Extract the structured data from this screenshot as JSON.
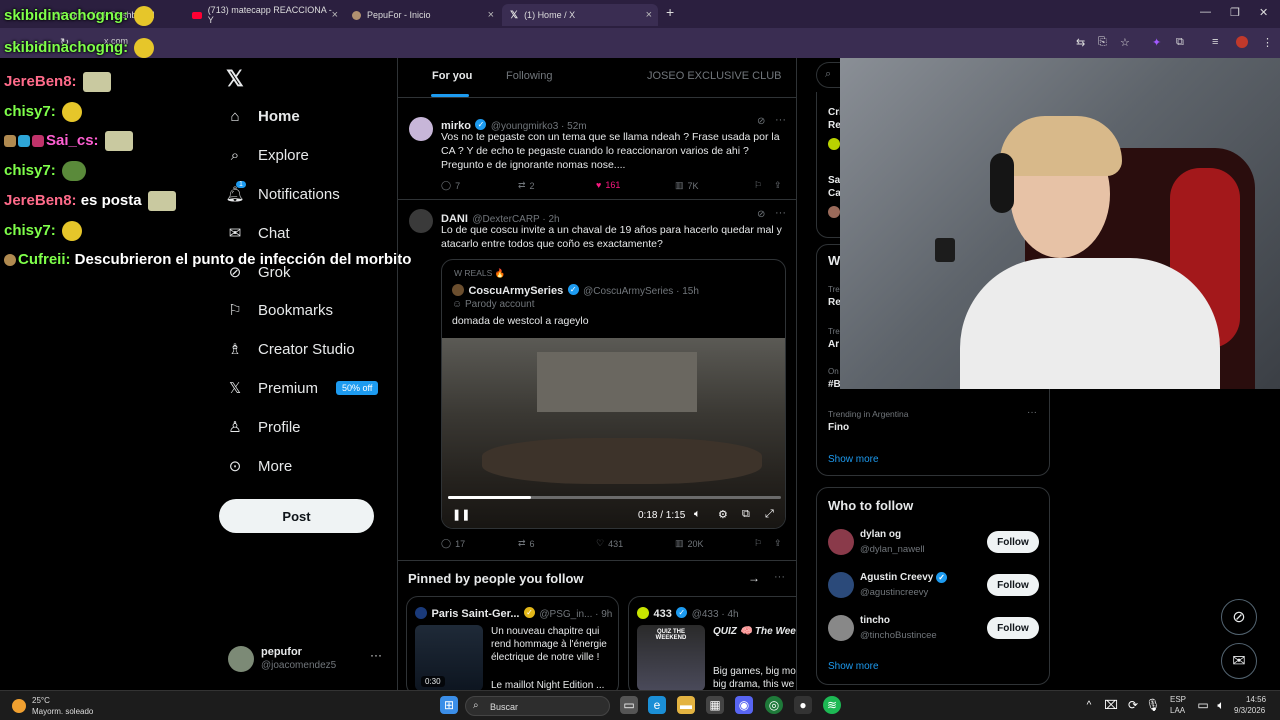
{
  "browser": {
    "tabs": [
      {
        "label": "Stream - Kick Dashboard"
      },
      {
        "label": "(713) matecapp REACCIONA - Y"
      },
      {
        "label": "PepuFor - Inicio"
      },
      {
        "label": "(1) Home / X"
      }
    ],
    "url": "x.com"
  },
  "chat": {
    "messages": [
      {
        "user": "skibidinachogng:",
        "color": "#7fff4a",
        "text": ""
      },
      {
        "user": "skibidinachogng:",
        "color": "#7fff4a",
        "text": ""
      },
      {
        "user": "JereBen8:",
        "color": "#ff6b8a",
        "text": ""
      },
      {
        "user": "chisy7:",
        "color": "#7fff4a",
        "text": ""
      },
      {
        "user": "Sai_cs:",
        "color": "#ff5fd2",
        "text": ""
      },
      {
        "user": "chisy7:",
        "color": "#7fff4a",
        "text": ""
      },
      {
        "user": "JereBen8:",
        "color": "#ff6b8a",
        "text": "es posta"
      },
      {
        "user": "chisy7:",
        "color": "#7fff4a",
        "text": ""
      },
      {
        "user": "Cufreii:",
        "color": "#7fff4a",
        "text": "Descubrieron el punto de infección del morbito"
      }
    ]
  },
  "nav": {
    "items": [
      {
        "label": "Home",
        "icon": "home-icon"
      },
      {
        "label": "Explore",
        "icon": "search-icon"
      },
      {
        "label": "Notifications",
        "icon": "bell-icon",
        "badge": "1"
      },
      {
        "label": "Chat",
        "icon": "mail-icon"
      },
      {
        "label": "Grok",
        "icon": "grok-icon"
      },
      {
        "label": "Bookmarks",
        "icon": "bookmark-icon"
      },
      {
        "label": "Creator Studio",
        "icon": "creator-icon"
      },
      {
        "label": "Premium",
        "icon": "x-icon",
        "promo": "50% off"
      },
      {
        "label": "Profile",
        "icon": "user-icon"
      },
      {
        "label": "More",
        "icon": "more-icon"
      }
    ],
    "post_label": "Post",
    "account": {
      "name": "pepufor",
      "handle": "@joacomendez5"
    }
  },
  "feed": {
    "tabs": [
      "For you",
      "Following",
      "JOSEO EXCLUSIVE CLUB"
    ],
    "tweets": [
      {
        "name": "mirko",
        "handle": "@youngmirko3 · 52m",
        "text": "Vos no te pegaste con un tema que se llama ndeah ? Frase usada por la CA ? Y de echo te pegaste cuando lo reaccionaron varios de ahi ? Pregunto e de ignorante nomas nose....",
        "replies": "7",
        "reposts": "2",
        "likes": "161",
        "views": "7K"
      },
      {
        "name": "DANI",
        "handle": "@DexterCARP · 2h",
        "text": "Lo de que coscu invite a un chaval de 19 años para hacerlo quedar mal y atacarlo entre todos que coño es exactamente?",
        "replies": "17",
        "reposts": "6",
        "likes": "431",
        "views": "20K",
        "quote": {
          "context": "W REALS 🔥",
          "name": "CoscuArmySeries",
          "handle": "@CoscuArmySeries · 15h",
          "label": "Parody account",
          "text": "domada de westcol a rageylo",
          "time": "0:18 / 1:15",
          "progress": 0.25
        }
      }
    ],
    "pinned_title": "Pinned by people you follow",
    "pinned": [
      {
        "name": "Paris Saint-Ger...",
        "handle": "@PSG_in... · 9h",
        "text": "Un nouveau chapitre qui rend hommage à l'énergie électrique de notre ville !",
        "text2": "Le maillot Night Edition ...",
        "duration": "0:30"
      },
      {
        "name": "433",
        "handle": "@433 · 4h",
        "text": "QUIZ 🧠 The Wee",
        "text2": "Big games, big mo big drama, this we",
        "thumb": "QUIZ THE WEEKEND"
      }
    ]
  },
  "trends": {
    "partial": [
      {
        "line1": "Cri",
        "line2": "Re"
      },
      {
        "line1": "Sa",
        "line2": "Ca"
      }
    ],
    "section_initial": "W",
    "rows": [
      {
        "meta": "Tre",
        "topic": "Re"
      },
      {
        "meta": "Tre",
        "topic": "Ar"
      },
      {
        "meta": "On",
        "topic": "#B"
      },
      {
        "meta": "Trending in Argentina",
        "topic": "Fino"
      }
    ],
    "show_more": "Show more"
  },
  "who_to_follow": {
    "title": "Who to follow",
    "users": [
      {
        "name": "dylan og",
        "handle": "@dylan_nawell",
        "verified": false
      },
      {
        "name": "Agustin Creevy",
        "handle": "@agustincreevy",
        "verified": true
      },
      {
        "name": "tincho",
        "handle": "@tinchoBustincee",
        "verified": false
      }
    ],
    "follow_label": "Follow",
    "show_more": "Show more"
  },
  "taskbar": {
    "weather_temp": "25°C",
    "weather_desc": "Mayorm. soleado",
    "search_placeholder": "Buscar",
    "lang": "ESP",
    "lang2": "LAA",
    "time": "14:56",
    "date": "9/3/2026"
  }
}
